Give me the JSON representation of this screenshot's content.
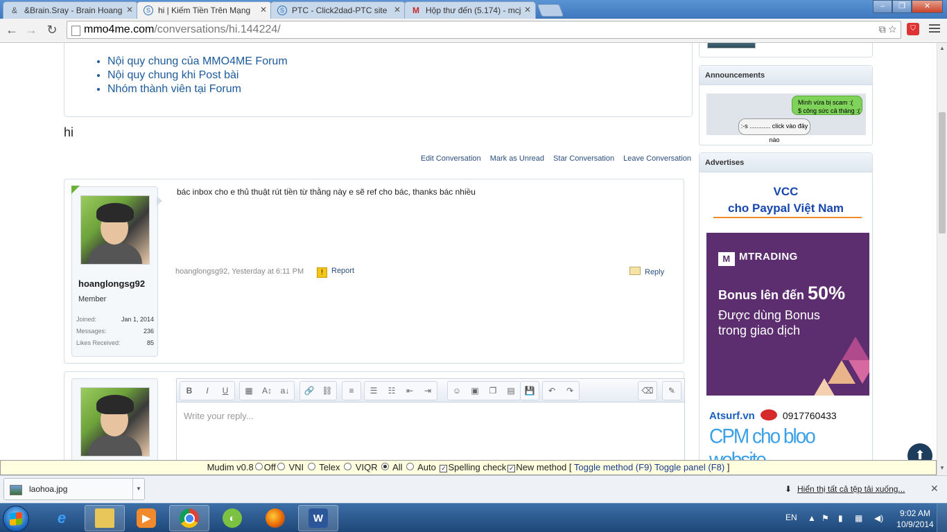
{
  "tabs": [
    {
      "title": "&Brain.Sray - Brain Hoang",
      "icon": "&",
      "active": false
    },
    {
      "title": "hi | Kiếm Tiền Trên Mạng",
      "icon": "S",
      "active": true
    },
    {
      "title": "PTC - Click2dad-PTC site",
      "icon": "S",
      "active": false
    },
    {
      "title": "Hộp thư đến (5.174) - mcj",
      "icon": "M",
      "active": false
    }
  ],
  "address": {
    "host": "mmo4me.com",
    "path": "/conversations/hi.144224/"
  },
  "rules": [
    "Nội quy chung của MMO4ME Forum",
    "Nội quy chung khi Post bài",
    "Nhóm thành viên tại Forum"
  ],
  "conversation": {
    "title": "hi",
    "actions": [
      "Edit Conversation",
      "Mark as Unread",
      "Star Conversation",
      "Leave Conversation"
    ]
  },
  "message": {
    "text": "bác inbox cho e thủ thuật rút tiền từ thằng này e sẽ ref cho bác, thanks bác nhiều",
    "meta": "hoanglongsg92, Yesterday at 6:11 PM",
    "report_label": "Report",
    "reply_label": "Reply",
    "user": {
      "name": "hoanglongsg92",
      "role": "Member",
      "stats": [
        {
          "label": "Joined:",
          "value": "Jan 1, 2014"
        },
        {
          "label": "Messages:",
          "value": "236"
        },
        {
          "label": "Likes Received:",
          "value": "85"
        }
      ]
    }
  },
  "editor": {
    "placeholder": "Write your reply...",
    "toolbar": [
      [
        "B",
        "I",
        "U"
      ],
      [
        "▦",
        "A↕",
        "a↓"
      ],
      [
        "🔗",
        "⛓"
      ],
      [
        "≡"
      ],
      [
        "☰",
        "☷",
        "⇤",
        "⇥"
      ],
      [
        "☺",
        "▣",
        "❐",
        "▤"
      ],
      [
        "💾"
      ],
      [
        "↶",
        "↷"
      ],
      [
        "⌫"
      ],
      [
        "✎"
      ]
    ]
  },
  "sidebar": {
    "announcements_title": "Announcements",
    "bubble1_line1": "Mình vừa bị scam :(",
    "bubble1_line2": "$ công sức cả tháng :(",
    "bubble2": ":-s ............ click vào đây nào",
    "advertises_title": "Advertises",
    "vcc_line1": "VCC",
    "vcc_line2": "cho Paypal Việt Nam",
    "mtrading_logo": "MTRADING",
    "mtrading_bonus": "Bonus lên đến",
    "mtrading_pct": "50%",
    "mtrading_sub1": "Được dùng Bonus",
    "mtrading_sub2": "trong giao dịch",
    "tsurf": "Atsurf.vn",
    "tsurf_phone": "0917760433",
    "cpm": "CPM cho bloo website"
  },
  "mudim": {
    "title": "Mudim v0.8",
    "options": [
      "Off",
      "VNI",
      "Telex",
      "VIQR",
      "All",
      "Auto"
    ],
    "selected": "All",
    "spelling": "Spelling check",
    "newmethod": "New method",
    "toggle_method": "Toggle method (F9)",
    "toggle_panel": "Toggle panel (F8)"
  },
  "downloads": {
    "file": "laohoa.jpg",
    "show_all": "Hiển thị tất cả tệp tải xuống..."
  },
  "taskbar": {
    "lang": "EN",
    "time": "9:02 AM",
    "date": "10/9/2014"
  },
  "colors": {
    "link": "#1c5a9c",
    "accent": "#1746b0",
    "mtrading": "#5c2d6f"
  }
}
